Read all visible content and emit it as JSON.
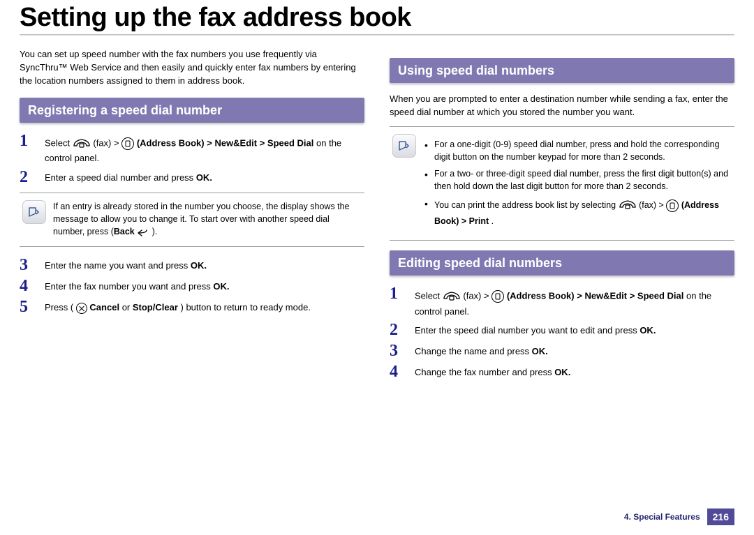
{
  "title": "Setting up the fax address book",
  "intro": "You can set up speed number with the fax numbers you use frequently via SyncThru™ Web Service and then easily and quickly enter fax numbers by entering the location numbers assigned to them in address book.",
  "left": {
    "heading": "Registering a speed dial number",
    "steps": [
      {
        "n": "1",
        "pre": "Select ",
        "post": " (fax) > ",
        "ab": "(Address Book) > ",
        "trail": "New&Edit > Speed Dial",
        "after": " on the control panel."
      },
      {
        "n": "2",
        "text": "Enter a speed dial number and press ",
        "ok": "OK."
      },
      {
        "n": "3",
        "text": "Enter the name you want and press ",
        "ok": "OK."
      },
      {
        "n": "4",
        "text": "Enter the fax number you want and press ",
        "ok": "OK."
      },
      {
        "n": "5",
        "pre": "Press (",
        "post": "Cancel",
        "or": " or ",
        "stop": "Stop/Clear",
        "after": ") button to return to ready mode."
      }
    ],
    "note": "If an entry is already stored in the number you choose, the display shows the message to allow you to change it. To start over with another speed dial number, press ",
    "noteBack": "Back ",
    "noteTrail": ")."
  },
  "right": {
    "heading1": "Using speed dial numbers",
    "para1": "When you are prompted to enter a destination number while sending a fax, enter the speed dial number at which you stored the number you want.",
    "note_items": [
      "For a one-digit (0-9) speed dial number, press and hold the corresponding digit button on the number keypad for more than 2 seconds.",
      "For a two- or three-digit speed dial number, press the first digit button(s) and then hold down the last digit button for more than 2 seconds."
    ],
    "note_print_pre": "You can print the address book list by selecting ",
    "note_print_fax": " (fax) > ",
    "note_print_ab": "(Address Book) > ",
    "note_print_bold": "Print",
    "note_print_after": ".",
    "heading2": "Editing speed dial numbers",
    "steps": [
      {
        "n": "1",
        "pre": "Select ",
        "post": " (fax) > ",
        "ab": "(Address Book) > ",
        "trail": "New&Edit > Speed Dial",
        "after": " on the control panel."
      },
      {
        "n": "2",
        "text": "Enter the speed dial number you want to edit and press ",
        "ok": "OK."
      },
      {
        "n": "3",
        "text": "Change the name and press ",
        "ok": "OK."
      },
      {
        "n": "4",
        "text": "Change the fax number and press ",
        "ok": "OK."
      }
    ]
  },
  "footer": {
    "chap": "4.  Special Features",
    "page": "216"
  }
}
